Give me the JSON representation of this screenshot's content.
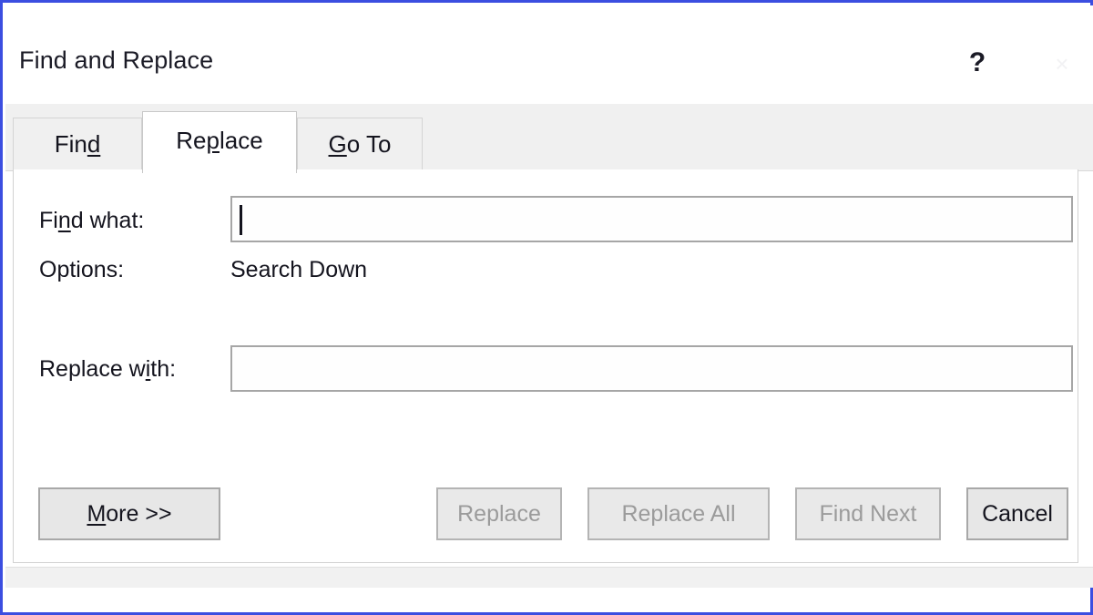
{
  "window": {
    "title": "Find and Replace",
    "help_label": "?",
    "close_label": "×"
  },
  "tabs": [
    {
      "id": "find",
      "label_before": "Fin",
      "label_accel": "d",
      "label_after": "",
      "active": false
    },
    {
      "id": "replace",
      "label_before": "Re",
      "label_accel": "p",
      "label_after": "lace",
      "active": true
    },
    {
      "id": "goto",
      "label_before": "",
      "label_accel": "G",
      "label_after": "o To",
      "active": false
    }
  ],
  "form": {
    "find_what": {
      "label_before": "Fi",
      "label_accel": "n",
      "label_after": "d what:",
      "value": "",
      "focused": true
    },
    "options": {
      "label": "Options:",
      "value": "Search Down"
    },
    "replace_with": {
      "label_before": "Replace w",
      "label_accel": "i",
      "label_after": "th:",
      "value": "",
      "focused": false
    }
  },
  "buttons": [
    {
      "id": "more",
      "label_before": "",
      "label_accel": "M",
      "label_after": "ore >>",
      "enabled": true
    },
    {
      "id": "replace",
      "label_before": "Replace",
      "label_accel": "",
      "label_after": "",
      "enabled": false
    },
    {
      "id": "replace_all",
      "label_before": "Replace All",
      "label_accel": "",
      "label_after": "",
      "enabled": false
    },
    {
      "id": "find_next",
      "label_before": "Find Next",
      "label_accel": "",
      "label_after": "",
      "enabled": false
    },
    {
      "id": "cancel",
      "label_before": "Cancel",
      "label_accel": "",
      "label_after": "",
      "enabled": true
    }
  ],
  "colors": {
    "frame_blue": "#3b4ee0",
    "dialog_bg": "#ffffff",
    "tabstrip_bg": "#f0f0f0",
    "button_bg": "#e7e7e7",
    "disabled_text": "#9b9b9b",
    "text": "#14141e"
  }
}
